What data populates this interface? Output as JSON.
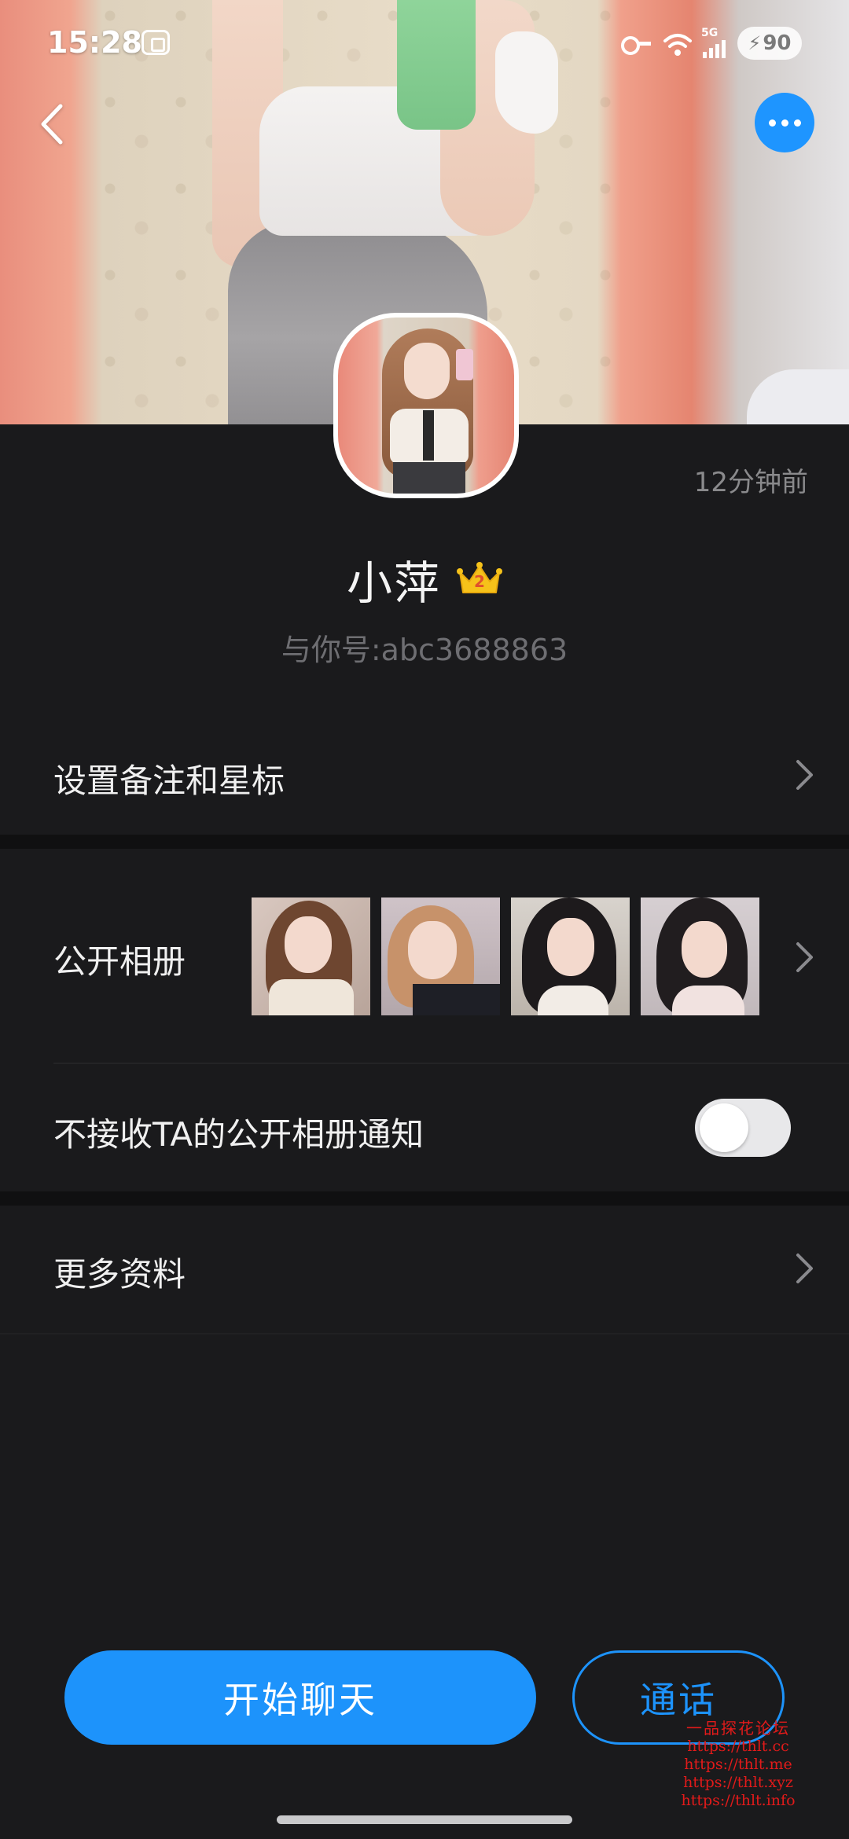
{
  "status_bar": {
    "time": "15:28",
    "network": "5G",
    "battery": "90",
    "icons": [
      "screenshot-icon",
      "key-icon",
      "wifi-icon",
      "signal-icon",
      "battery-charging-icon"
    ]
  },
  "nav": {
    "back_icon": "chevron-left-icon",
    "more_icon": "more-dots-icon",
    "accent_color": "#1e95ff"
  },
  "profile": {
    "last_seen": "12分钟前",
    "name": "小萍",
    "badge_level": "2",
    "badge_icon": "crown-icon",
    "id_line": "与你号:abc3688863"
  },
  "rows": {
    "remark": {
      "label": "设置备注和星标"
    },
    "album": {
      "label": "公开相册",
      "thumbnail_count": 4
    },
    "album_notify": {
      "label": "不接收TA的公开相册通知",
      "toggle_on": false
    },
    "more_info": {
      "label": "更多资料"
    }
  },
  "actions": {
    "chat_label": "开始聊天",
    "call_label": "通话"
  },
  "watermark": {
    "title": "一品探花论坛",
    "urls": [
      "https://thlt.cc",
      "https://thlt.me",
      "https://thlt.xyz",
      "https://thlt.info"
    ]
  }
}
